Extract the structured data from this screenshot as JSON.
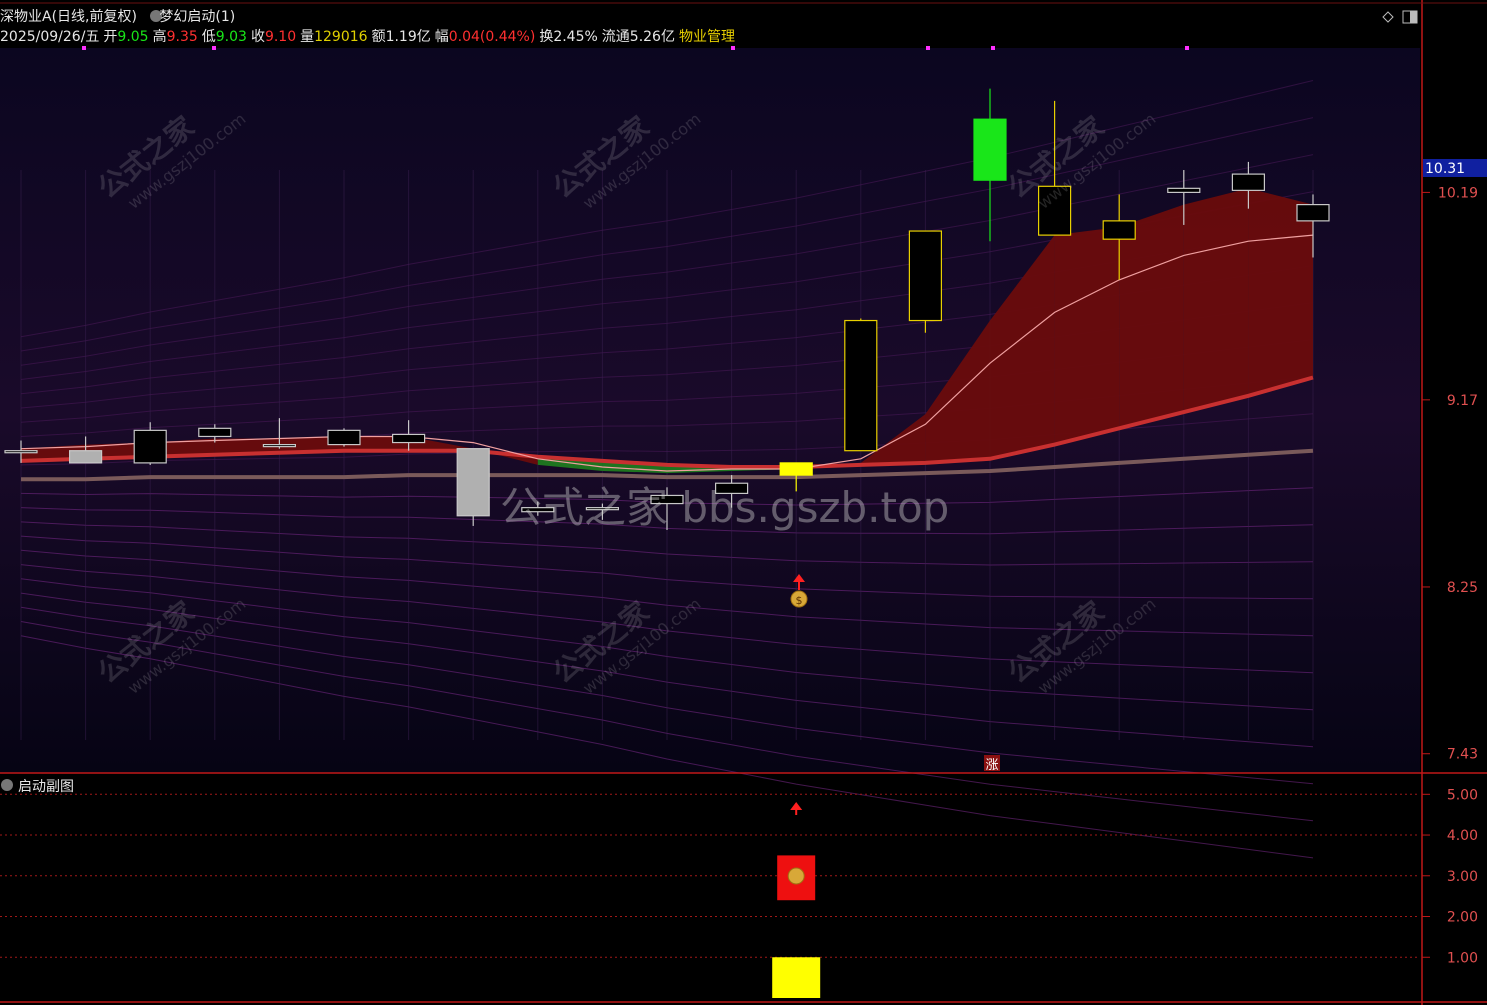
{
  "header": {
    "stock": "深物业A(日线,前复权)",
    "indicator": "梦幻启动(1)"
  },
  "info": {
    "date": "2025/09/26/五",
    "open_label": "开",
    "open": "9.05",
    "high_label": "高",
    "high": "9.35",
    "low_label": "低",
    "low": "9.03",
    "close_label": "收",
    "close": "9.10",
    "volume_label": "量",
    "volume": "129016",
    "amount_label": "额",
    "amount": "1.19亿",
    "change_label": "幅",
    "change": "0.04(0.44%)",
    "turnover_label": "换",
    "turnover": "2.45%",
    "float_label": "流通",
    "float": "5.26亿",
    "sector": "物业管理"
  },
  "sub": {
    "title": "启动副图"
  },
  "markers": {
    "zhang": "涨"
  },
  "watermarks": {
    "brand": "公式之家",
    "site": "www.gszj100.com",
    "center": "公式之家 bbs.gszb.top"
  },
  "colors": {
    "up": "#e8d000",
    "down_body": "#000000",
    "green": "#19e619",
    "gray": "#b0b0b0",
    "band_red": "#6a0c0c",
    "band_green": "#1f7a1f",
    "axis": "#c01818"
  },
  "chart_data": [
    {
      "type": "candlestick",
      "price_axis": {
        "ticks": [
          "10.19",
          "9.17",
          "8.25",
          "7.43"
        ],
        "current": "10.31",
        "ylim": [
          7.35,
          10.9
        ]
      },
      "candles": [
        {
          "o": 8.91,
          "h": 8.97,
          "l": 8.86,
          "c": 8.92,
          "color": "gray"
        },
        {
          "o": 8.92,
          "h": 8.99,
          "l": 8.86,
          "c": 8.86,
          "color": "gray"
        },
        {
          "o": 8.86,
          "h": 9.06,
          "l": 8.85,
          "c": 9.02,
          "color": "gray"
        },
        {
          "o": 8.99,
          "h": 9.05,
          "l": 8.96,
          "c": 9.03,
          "color": "gray"
        },
        {
          "o": 8.94,
          "h": 9.08,
          "l": 8.93,
          "c": 8.95,
          "color": "gray"
        },
        {
          "o": 8.95,
          "h": 9.03,
          "l": 8.94,
          "c": 9.02,
          "color": "gray"
        },
        {
          "o": 8.96,
          "h": 9.07,
          "l": 8.92,
          "c": 9.0,
          "color": "gray"
        },
        {
          "o": 8.93,
          "h": 8.93,
          "l": 8.55,
          "c": 8.6,
          "color": "gray"
        },
        {
          "o": 8.62,
          "h": 8.67,
          "l": 8.6,
          "c": 8.64,
          "color": "gray"
        },
        {
          "o": 8.63,
          "h": 8.66,
          "l": 8.58,
          "c": 8.64,
          "color": "gray"
        },
        {
          "o": 8.66,
          "h": 8.74,
          "l": 8.53,
          "c": 8.7,
          "color": "gray"
        },
        {
          "o": 8.71,
          "h": 8.8,
          "l": 8.64,
          "c": 8.76,
          "color": "gray"
        },
        {
          "o": 8.8,
          "h": 8.86,
          "l": 8.72,
          "c": 8.86,
          "color": "yellow"
        },
        {
          "o": 8.92,
          "h": 9.57,
          "l": 8.92,
          "c": 9.56,
          "color": "up"
        },
        {
          "o": 9.56,
          "h": 10.0,
          "l": 9.5,
          "c": 10.0,
          "color": "up"
        },
        {
          "o": 10.55,
          "h": 10.7,
          "l": 9.95,
          "c": 10.25,
          "color": "green"
        },
        {
          "o": 9.98,
          "h": 10.64,
          "l": 9.98,
          "c": 10.22,
          "color": "up"
        },
        {
          "o": 9.96,
          "h": 10.18,
          "l": 9.76,
          "c": 10.05,
          "color": "up"
        },
        {
          "o": 10.19,
          "h": 10.3,
          "l": 10.03,
          "c": 10.21,
          "color": "gray"
        },
        {
          "o": 10.2,
          "h": 10.34,
          "l": 10.11,
          "c": 10.28,
          "color": "gray"
        },
        {
          "o": 10.05,
          "h": 10.18,
          "l": 9.87,
          "c": 10.13,
          "color": "gray"
        }
      ],
      "ma_line": [
        8.93,
        8.94,
        8.96,
        8.97,
        8.98,
        8.99,
        8.99,
        8.96,
        8.88,
        8.84,
        8.82,
        8.83,
        8.83,
        8.88,
        9.05,
        9.35,
        9.6,
        9.76,
        9.88,
        9.95,
        9.98
      ],
      "ma_mid": [
        8.87,
        8.88,
        8.89,
        8.9,
        8.91,
        8.92,
        8.92,
        8.92,
        8.89,
        8.87,
        8.85,
        8.84,
        8.84,
        8.85,
        8.86,
        8.88,
        8.95,
        9.03,
        9.11,
        9.19,
        9.28
      ],
      "ma_slow": [
        8.78,
        8.78,
        8.79,
        8.79,
        8.79,
        8.79,
        8.8,
        8.8,
        8.8,
        8.8,
        8.79,
        8.79,
        8.79,
        8.8,
        8.81,
        8.82,
        8.84,
        8.86,
        8.88,
        8.9,
        8.92
      ],
      "band_top": [
        8.93,
        8.95,
        8.96,
        8.98,
        8.98,
        8.99,
        8.99,
        8.93,
        8.85,
        8.82,
        8.81,
        8.82,
        8.83,
        8.86,
        9.1,
        9.56,
        9.98,
        10.02,
        10.13,
        10.21,
        10.13
      ]
    },
    {
      "type": "bar",
      "title": "启动副图",
      "y_ticks": [
        "5.00",
        "4.00",
        "3.00",
        "2.00",
        "1.00"
      ],
      "ylim": [
        0,
        5.4
      ],
      "bars": [
        {
          "index": 12,
          "value": 1.0,
          "color": "yellow"
        },
        {
          "index": 12,
          "value_low": 2.4,
          "value": 3.5,
          "color": "red"
        }
      ]
    }
  ]
}
